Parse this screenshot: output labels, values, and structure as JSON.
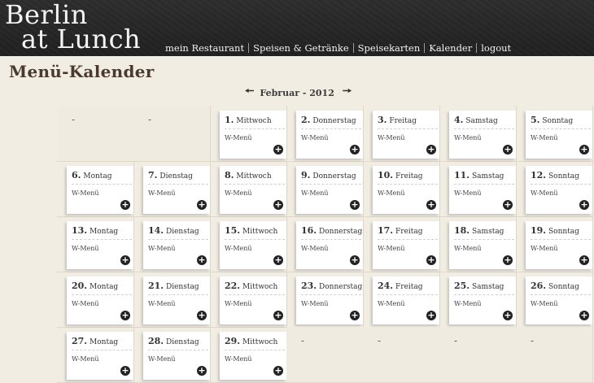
{
  "logo": {
    "line1": "Berlin",
    "line2": "at Lunch"
  },
  "nav": [
    {
      "label": "mein Restaurant"
    },
    {
      "label": "Speisen & Getränke"
    },
    {
      "label": "Speisekarten"
    },
    {
      "label": "Kalender"
    },
    {
      "label": "logout"
    }
  ],
  "page_title": "Menü-Kalender",
  "month_label": "Februar - 2012",
  "menu_label": "W-Menü",
  "empty_label": "-",
  "weeks": [
    [
      {
        "empty": true
      },
      {
        "empty": true
      },
      {
        "num": "1.",
        "day": "Mittwoch"
      },
      {
        "num": "2.",
        "day": "Donnerstag"
      },
      {
        "num": "3.",
        "day": "Freitag"
      },
      {
        "num": "4.",
        "day": "Samstag"
      },
      {
        "num": "5.",
        "day": "Sonntag"
      }
    ],
    [
      {
        "num": "6.",
        "day": "Montag"
      },
      {
        "num": "7.",
        "day": "Dienstag"
      },
      {
        "num": "8.",
        "day": "Mittwoch"
      },
      {
        "num": "9.",
        "day": "Donnerstag"
      },
      {
        "num": "10.",
        "day": "Freitag"
      },
      {
        "num": "11.",
        "day": "Samstag"
      },
      {
        "num": "12.",
        "day": "Sonntag"
      }
    ],
    [
      {
        "num": "13.",
        "day": "Montag"
      },
      {
        "num": "14.",
        "day": "Dienstag"
      },
      {
        "num": "15.",
        "day": "Mittwoch"
      },
      {
        "num": "16.",
        "day": "Donnerstag"
      },
      {
        "num": "17.",
        "day": "Freitag"
      },
      {
        "num": "18.",
        "day": "Samstag"
      },
      {
        "num": "19.",
        "day": "Sonntag"
      }
    ],
    [
      {
        "num": "20.",
        "day": "Montag"
      },
      {
        "num": "21.",
        "day": "Dienstag"
      },
      {
        "num": "22.",
        "day": "Mittwoch"
      },
      {
        "num": "23.",
        "day": "Donnerstag"
      },
      {
        "num": "24.",
        "day": "Freitag"
      },
      {
        "num": "25.",
        "day": "Samstag"
      },
      {
        "num": "26.",
        "day": "Sonntag"
      }
    ],
    [
      {
        "num": "27.",
        "day": "Montag"
      },
      {
        "num": "28.",
        "day": "Dienstag"
      },
      {
        "num": "29.",
        "day": "Mittwoch"
      },
      {
        "empty": true
      },
      {
        "empty": true
      },
      {
        "empty": true
      },
      {
        "empty": true
      }
    ]
  ]
}
